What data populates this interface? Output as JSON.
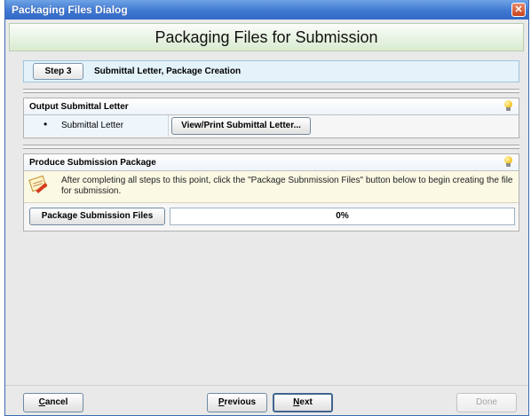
{
  "window": {
    "title": "Packaging Files Dialog",
    "close_glyph": "✕"
  },
  "header": {
    "title": "Packaging Files for Submission"
  },
  "step": {
    "button_label": "Step 3",
    "description": "Submittal Letter, Package Creation"
  },
  "output_section": {
    "heading": "Output Submittal Letter",
    "bullet": "•",
    "item_label": "Submittal Letter",
    "button_label": "View/Print Submittal Letter..."
  },
  "package_section": {
    "heading": "Produce Submission Package",
    "info_text": "After completing all steps to this point, click the \"Package Subnmission Files\" button below to begin creating the file for submission.",
    "button_label": "Package Submission Files",
    "progress": {
      "value": 0,
      "label": "0%"
    }
  },
  "footer": {
    "cancel": {
      "mnemonic": "C",
      "rest": "ancel"
    },
    "previous": {
      "mnemonic": "P",
      "rest": "revious"
    },
    "next": {
      "mnemonic": "N",
      "rest": "ext"
    },
    "done": "Done"
  },
  "icons": [
    "close-icon",
    "lightbulb-icon",
    "note-pencil-icon"
  ],
  "colors": {
    "title_bar": "#3f78d2",
    "header_bg": "#d8ebd0",
    "step_bar_bg": "#e4f2fa",
    "info_bg": "#fbf9e4"
  }
}
